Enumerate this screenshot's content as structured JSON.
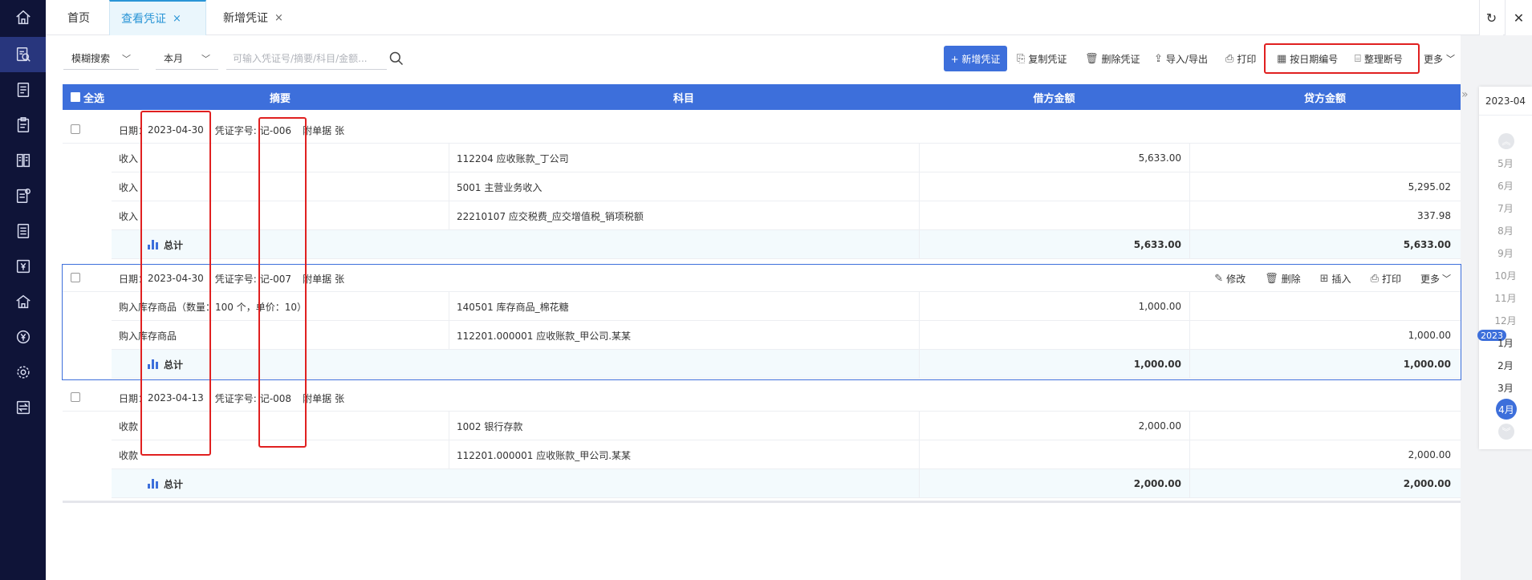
{
  "tabs": [
    {
      "label": "首页",
      "closable": false
    },
    {
      "label": "查看凭证",
      "closable": true,
      "active": true
    },
    {
      "label": "新增凭证",
      "closable": true
    }
  ],
  "topbar": {
    "refresh_icon": "refresh-icon",
    "close_glyph": "✕",
    "refresh_glyph": "↻",
    "tab_close": "×"
  },
  "sidebar": {
    "icons": [
      "home-icon",
      "voucher-search-icon",
      "list-icon",
      "clipboard-icon",
      "ledger-icon",
      "report-icon",
      "document-icon",
      "yen-icon",
      "building-icon",
      "currency-icon",
      "gear-icon",
      "transfer-icon"
    ]
  },
  "toolbar": {
    "search_mode": "模糊搜索",
    "period": "本月",
    "search_placeholder": "可输入凭证号/摘要/科目/金额...",
    "new_voucher": "+ 新增凭证",
    "copy_voucher": "复制凭证",
    "delete_voucher": "删除凭证",
    "import_export": "导入/导出",
    "print": "打印",
    "renumber_by_date": "按日期编号",
    "tidy_number": "整理断号",
    "more": "更多"
  },
  "table": {
    "select_all": "全选",
    "col_summary": "摘要",
    "col_account": "科目",
    "col_debit": "借方金额",
    "col_credit": "贷方金额"
  },
  "labels": {
    "date": "日期：",
    "voucher_word": "凭证字号:",
    "attachments": "附单据",
    "attachments_unit": "张",
    "total": "总计",
    "edit": "修改",
    "delete": "删除",
    "insert": "插入",
    "print": "打印",
    "more": "更多"
  },
  "vouchers": [
    {
      "date": "2023-04-30",
      "number": "记-006",
      "rows": [
        {
          "summary": "收入",
          "account": "112204  应收账款_丁公司",
          "debit": "5,633.00",
          "credit": ""
        },
        {
          "summary": "收入",
          "account": "5001  主营业务收入",
          "debit": "",
          "credit": "5,295.02"
        },
        {
          "summary": "收入",
          "account": "22210107  应交税费_应交增值税_销项税额",
          "debit": "",
          "credit": "337.98"
        }
      ],
      "total_debit": "5,633.00",
      "total_credit": "5,633.00"
    },
    {
      "date": "2023-04-30",
      "number": "记-007",
      "rows": [
        {
          "summary": "购入库存商品（数量：100 个，单价：10）",
          "account": "140501  库存商品_棉花糖",
          "debit": "1,000.00",
          "credit": ""
        },
        {
          "summary": "购入库存商品",
          "account": "112201.000001  应收账款_甲公司.某某",
          "debit": "",
          "credit": "1,000.00"
        }
      ],
      "total_debit": "1,000.00",
      "total_credit": "1,000.00"
    },
    {
      "date": "2023-04-13",
      "number": "记-008",
      "rows": [
        {
          "summary": "收款",
          "account": "1002  银行存款",
          "debit": "2,000.00",
          "credit": ""
        },
        {
          "summary": "收款",
          "account": "112201.000001  应收账款_甲公司.某某",
          "debit": "",
          "credit": "2,000.00"
        }
      ],
      "total_debit": "2,000.00",
      "total_credit": "2,000.00"
    }
  ],
  "date_rail": {
    "current": "2023-04",
    "months": [
      "5月",
      "6月",
      "7月",
      "8月",
      "9月",
      "10月",
      "11月",
      "12月",
      "1月",
      "2月",
      "3月",
      "4月"
    ],
    "year_badge": "2023",
    "selected": "4月",
    "up_glyph": "︽",
    "down_glyph": "︾"
  },
  "colors": {
    "accent": "#3d6fdb",
    "sidebar": "#0f1438",
    "highlight": "#e02020",
    "tab_active": "#2a95d6"
  }
}
